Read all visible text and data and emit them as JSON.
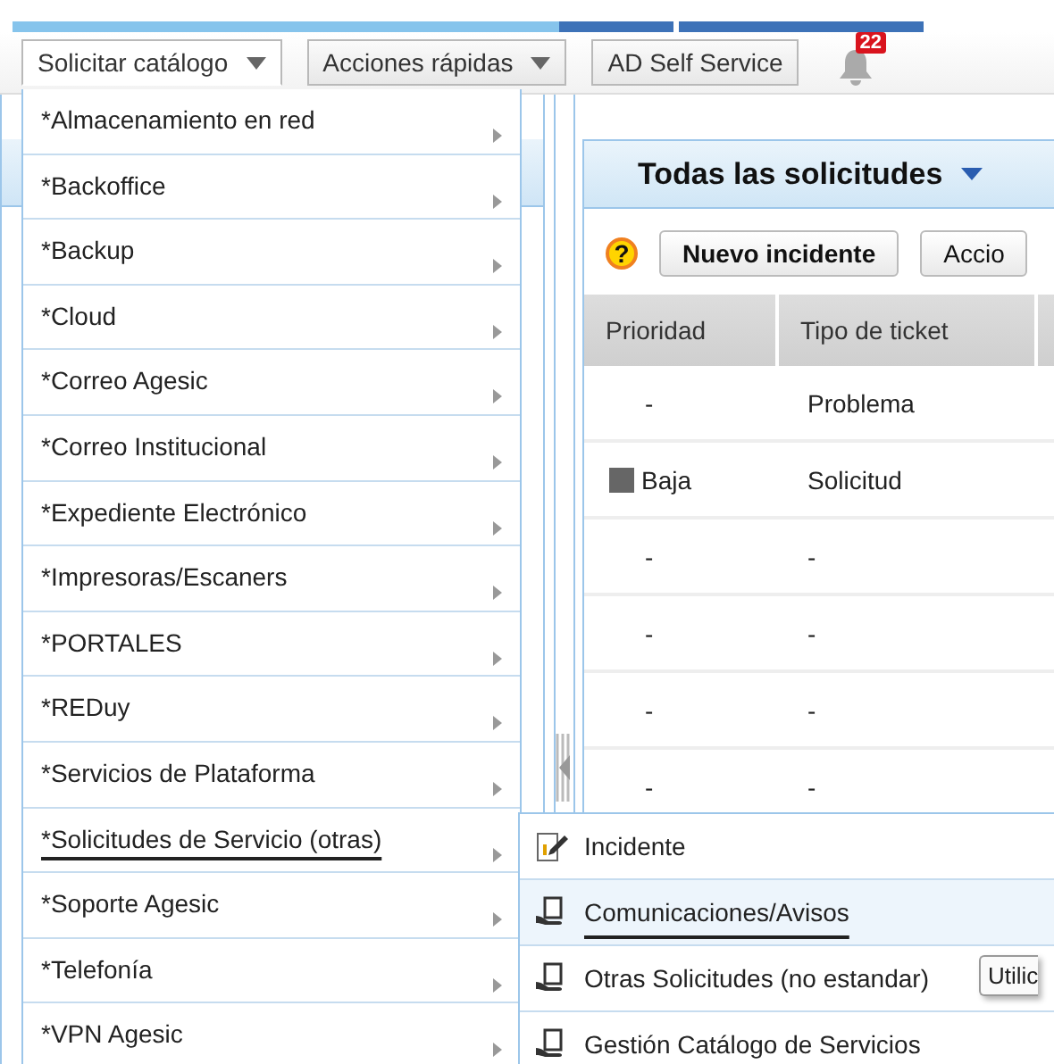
{
  "toolbar": {
    "buttons": [
      {
        "label": "Solicitar catálogo",
        "kind": "dropdown",
        "selected": true
      },
      {
        "label": "Acciones rápidas",
        "kind": "dropdown",
        "selected": false
      },
      {
        "label": "AD Self Service",
        "kind": "plain",
        "selected": false
      }
    ],
    "notifications": {
      "count": "22"
    }
  },
  "panel": {
    "title": "Todas las solicitudes",
    "help": "?",
    "buttons": [
      "Nuevo incidente",
      "Accio"
    ],
    "table": {
      "columns": [
        "Prioridad",
        "Tipo de ticket"
      ],
      "rows": [
        {
          "priority": "-",
          "type": "Problema"
        },
        {
          "priority": "Baja",
          "color": "#666666",
          "type": "Solicitud"
        },
        {
          "priority": "-",
          "type": "-"
        },
        {
          "priority": "-",
          "type": "-"
        },
        {
          "priority": "-",
          "type": "-"
        },
        {
          "priority": "-",
          "type": "-"
        }
      ]
    }
  },
  "menu": {
    "items": [
      {
        "label": "*Almacenamiento en red",
        "selected": false
      },
      {
        "label": "*Backoffice",
        "selected": false
      },
      {
        "label": "*Backup",
        "selected": false
      },
      {
        "label": "*Cloud",
        "selected": false
      },
      {
        "label": "*Correo Agesic",
        "selected": false
      },
      {
        "label": "*Correo Institucional",
        "selected": false
      },
      {
        "label": "*Expediente Electrónico",
        "selected": false
      },
      {
        "label": "*Impresoras/Escaners",
        "selected": false
      },
      {
        "label": "*PORTALES",
        "selected": false
      },
      {
        "label": "*REDuy",
        "selected": false
      },
      {
        "label": "*Servicios de Plataforma",
        "selected": false
      },
      {
        "label": "*Solicitudes de Servicio (otras)",
        "selected": true
      },
      {
        "label": "*Soporte Agesic",
        "selected": false
      },
      {
        "label": "*Telefonía",
        "selected": false
      },
      {
        "label": "*VPN Agesic",
        "selected": false
      }
    ]
  },
  "submenu": {
    "items": [
      {
        "label": "Incidente",
        "kind": "edit",
        "selected": false
      },
      {
        "label": "Comunicaciones/Avisos",
        "kind": "request",
        "selected": true
      },
      {
        "label": "Otras Solicitudes (no estandar)",
        "kind": "request",
        "selected": false
      },
      {
        "label": "Gestión Catálogo de Servicios",
        "kind": "request",
        "selected": false
      }
    ]
  },
  "tooltip": "Utilic"
}
